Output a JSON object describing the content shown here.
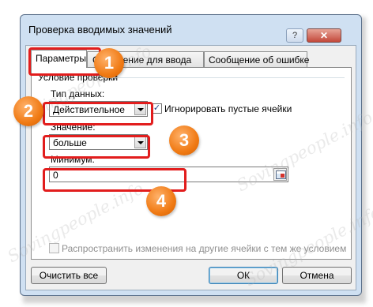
{
  "dialog": {
    "title": "Проверка вводимых значений",
    "help": "?",
    "close": "✕"
  },
  "tabs": [
    {
      "label": "Параметры"
    },
    {
      "label": "Сообщение для ввода"
    },
    {
      "label": "Сообщение об ошибке"
    }
  ],
  "validation": {
    "group_label": "Условие проверки",
    "datatype_label": "Тип данных:",
    "datatype_value": "Действительное",
    "ignore_blank_label": "Игнорировать пустые ячейки",
    "ignore_blank_checked": "✓",
    "value_label": "Значение:",
    "value_value": "больше",
    "minimum_label": "Минимум:",
    "minimum_value": "0",
    "apply_all_label": "Распространить изменения на другие ячейки с тем же условием"
  },
  "buttons": {
    "clear_all": "Очистить все",
    "ok": "ОК",
    "cancel": "Отмена"
  },
  "callouts": [
    "1",
    "2",
    "3",
    "4"
  ],
  "watermark": "Sovingpeople.info",
  "colors": {
    "callout_red": "#e21d1d",
    "badge_orange": "#f07a14"
  }
}
